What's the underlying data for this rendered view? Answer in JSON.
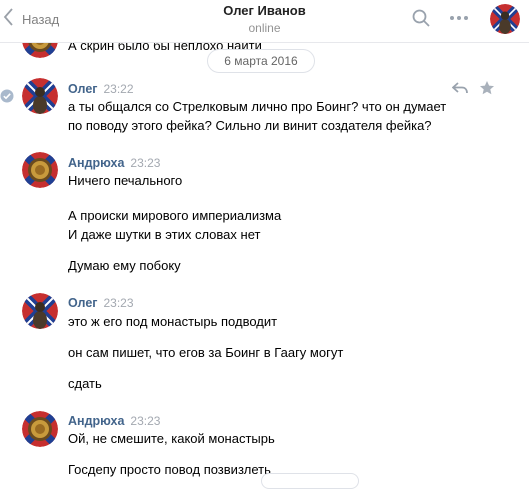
{
  "header": {
    "back_label": "Назад",
    "peer_name": "Олег Иванов",
    "peer_status": "online"
  },
  "date_divider": "6 марта 2016",
  "partial_message": "А скрин было бы неплохо найти",
  "messages": [
    {
      "author": "Олег",
      "time": "23:22",
      "lines": [
        "а ты общался со Стрелковым лично про Боинг? что он думает",
        "по поводу этого фейка? Сильно ли винит создателя фейка?"
      ]
    },
    {
      "author": "Андрюха",
      "time": "23:23",
      "lines": [
        "Ничего печального",
        "А происки мирового империализма",
        "И даже шутки в этих словах нет",
        "Думаю ему побоку"
      ]
    },
    {
      "author": "Олег",
      "time": "23:23",
      "lines": [
        "это ж его под монастырь подводит",
        "он сам пишет, что егов за Боинг в Гаагу могут",
        "сдать"
      ]
    },
    {
      "author": "Андрюха",
      "time": "23:23",
      "lines": [
        "Ой, не смешите, какой монастырь",
        "Госдепу просто повод позвизлеть"
      ]
    }
  ],
  "icons": {
    "back": "chevron-left-icon",
    "search": "search-icon",
    "more": "more-icon",
    "reply": "reply-icon",
    "favorite": "star-icon",
    "read": "check-icon"
  },
  "colors": {
    "author": "#42648b",
    "time": "#a3a8b0",
    "divider": "#e7e8ec"
  }
}
